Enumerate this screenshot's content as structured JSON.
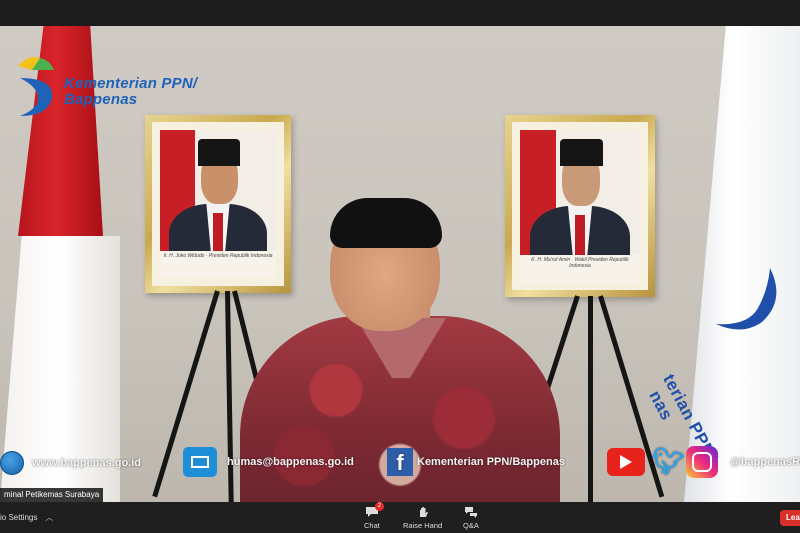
{
  "logo": {
    "line1": "Kementerian PPN/",
    "line2": "Bappenas",
    "icon": "bappenas-logo-icon"
  },
  "portraits": [
    {
      "caption": "Ir. H. Joko Widodo · Presiden Republik Indonesia"
    },
    {
      "caption": "K. H. Ma'ruf Amin · Wakil Presiden Republik Indonesia"
    }
  ],
  "banner": {
    "text": "terian PPN/",
    "line2": "nas"
  },
  "overlay": {
    "website": "www.bappenas.go.id",
    "email": "humas@bappenas.go.id",
    "facebook": "Kementerian PPN/Bappenas",
    "instagram": "@bappenasRI",
    "icons": [
      "globe-icon",
      "mail-icon",
      "facebook-icon",
      "youtube-icon",
      "twitter-icon",
      "instagram-icon"
    ]
  },
  "participant": {
    "name": "minal Petikemas Surabaya"
  },
  "toolbar": {
    "audio_settings": "io Settings",
    "chat": "Chat",
    "chat_badge": "2",
    "raise_hand": "Raise Hand",
    "qa": "Q&A",
    "leave": "Leav"
  },
  "colors": {
    "zoom_bar": "#1f1f1f",
    "leave": "#d9302c",
    "brand_blue": "#1f63b8"
  }
}
